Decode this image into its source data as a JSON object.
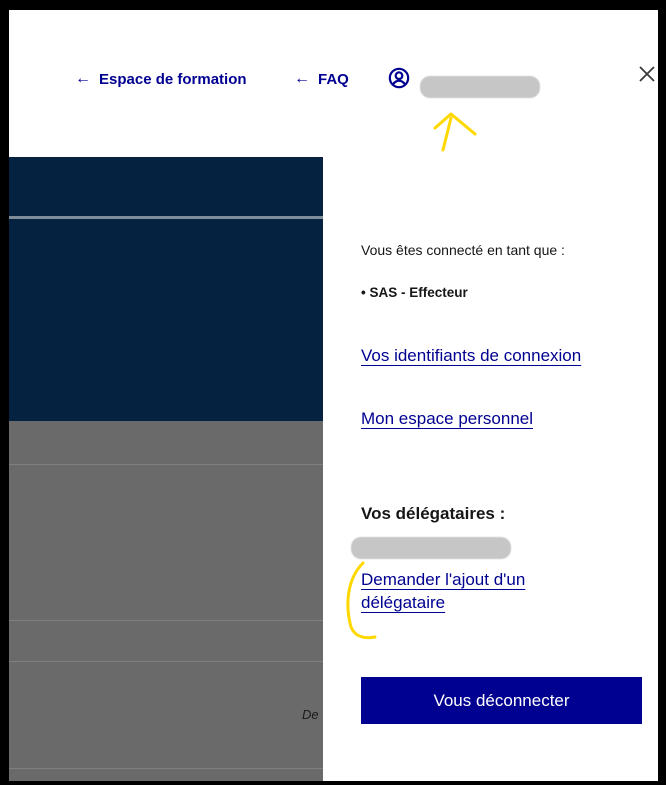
{
  "header": {
    "training_link": "Espace de formation",
    "faq_link": "FAQ",
    "user_name": "",
    "back_arrow": "←"
  },
  "panel": {
    "connected_label": "Vous êtes connecté en tant que :",
    "roles": [
      "SAS - Effecteur"
    ],
    "credentials_link": "Vos identifiants de connexion",
    "personal_space_link": "Mon espace personnel",
    "delegates_heading": "Vos délégataires :",
    "request_delegate_link": "Demander l'ajout d'un délégataire",
    "logout_button": "Vous déconnecter"
  },
  "background": {
    "partial_text": "De"
  },
  "icons": {
    "user": "user-circle-icon",
    "close": "close-icon",
    "arrow": "arrow-left-icon"
  },
  "colors": {
    "primary": "#000091",
    "dark_bg": "#052341",
    "annotation": "#ffd800"
  }
}
